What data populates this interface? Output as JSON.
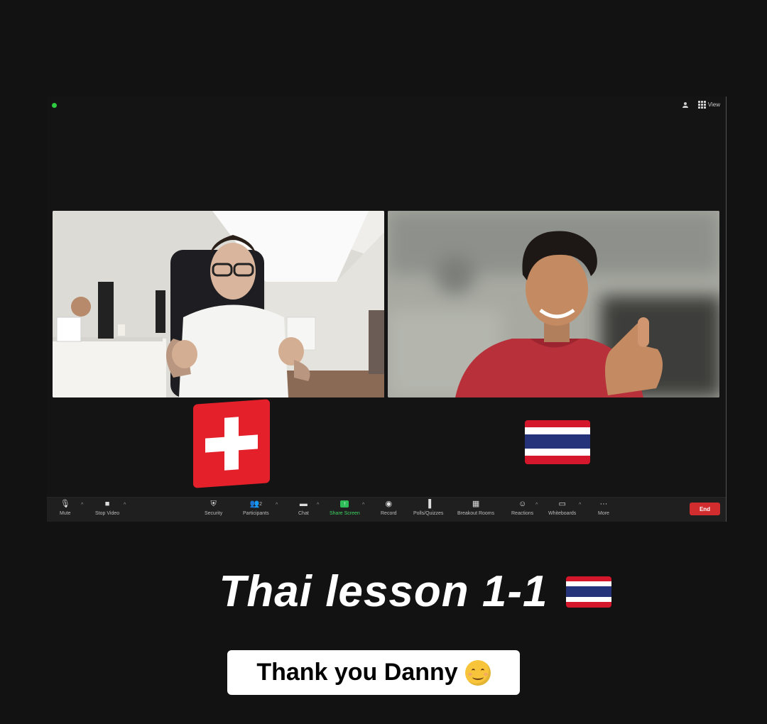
{
  "meeting": {
    "view_label": "View",
    "participants_count": "2"
  },
  "participants": [
    {
      "name_hint": "left-participant",
      "flag": "switzerland-flag"
    },
    {
      "name_hint": "right-participant",
      "flag": "thailand-flag"
    }
  ],
  "toolbar": {
    "items": [
      {
        "label": "Mute",
        "icon": "microphone-icon"
      },
      {
        "label": "Stop Video",
        "icon": "video-camera-icon"
      },
      {
        "label": "Security",
        "icon": "shield-icon"
      },
      {
        "label": "Participants",
        "icon": "participants-icon"
      },
      {
        "label": "Chat",
        "icon": "chat-icon"
      },
      {
        "label": "Share Screen",
        "icon": "share-screen-icon"
      },
      {
        "label": "Record",
        "icon": "record-icon"
      },
      {
        "label": "Polls/Quizzes",
        "icon": "poll-icon"
      },
      {
        "label": "Breakout Rooms",
        "icon": "breakout-icon"
      },
      {
        "label": "Reactions",
        "icon": "reaction-icon"
      },
      {
        "label": "Whiteboards",
        "icon": "whiteboard-icon"
      },
      {
        "label": "More",
        "icon": "more-icon"
      }
    ],
    "end_label": "End"
  },
  "caption": {
    "title": "Thai lesson 1-1",
    "subtitle": "Thank you Danny"
  },
  "colors": {
    "background": "#121212",
    "end_button": "#d12d2f",
    "share_green": "#2ebd59"
  }
}
